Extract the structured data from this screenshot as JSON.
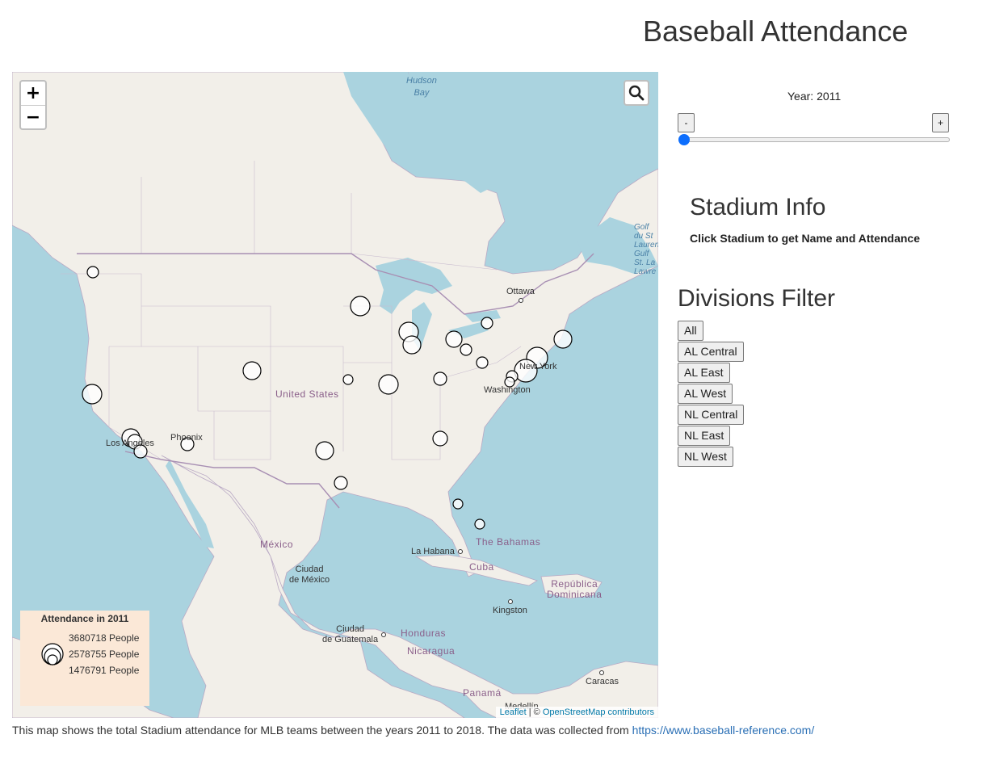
{
  "header": {
    "title": "Baseball Attendance"
  },
  "map": {
    "zoom_in_label": "+",
    "zoom_out_label": "−",
    "search_icon": "search-icon",
    "labels": [
      {
        "key": "hudson",
        "text": "Hudson\nBay",
        "kind": "water"
      },
      {
        "key": "golf",
        "text": "Golf\ndu St\nLauren\nGulf\nSt. La\nLawre",
        "kind": "water"
      },
      {
        "key": "ottawa",
        "text": "Ottawa",
        "kind": "city"
      },
      {
        "key": "newyork",
        "text": "New York",
        "kind": "city"
      },
      {
        "key": "washington",
        "text": "Washington",
        "kind": "city"
      },
      {
        "key": "usa",
        "text": "United States",
        "kind": "country"
      },
      {
        "key": "phoenix",
        "text": "Phoenix",
        "kind": "city"
      },
      {
        "key": "losangeles",
        "text": "Los Angeles",
        "kind": "city"
      },
      {
        "key": "mexico",
        "text": "México",
        "kind": "country"
      },
      {
        "key": "cdmx",
        "text": "Ciudad\nde México",
        "kind": "city"
      },
      {
        "key": "bahamas",
        "text": "The Bahamas",
        "kind": "country"
      },
      {
        "key": "habana",
        "text": "La Habana",
        "kind": "city"
      },
      {
        "key": "cuba",
        "text": "Cuba",
        "kind": "country"
      },
      {
        "key": "repdom",
        "text": "República\nDominicana",
        "kind": "country"
      },
      {
        "key": "kingston",
        "text": "Kingston",
        "kind": "city"
      },
      {
        "key": "honduras",
        "text": "Honduras",
        "kind": "country"
      },
      {
        "key": "guatemala",
        "text": "Ciudad\nde Guatemala",
        "kind": "city"
      },
      {
        "key": "nicaragua",
        "text": "Nicaragua",
        "kind": "country"
      },
      {
        "key": "caracas",
        "text": "Caracas",
        "kind": "city"
      },
      {
        "key": "panama",
        "text": "Panamá",
        "kind": "country"
      },
      {
        "key": "medellin",
        "text": "Medellín",
        "kind": "city"
      }
    ],
    "legend": {
      "title": "Attendance in 2011",
      "entries": [
        "3680718 People",
        "2578755 People",
        "1476791 People"
      ]
    },
    "attribution": {
      "leaflet": "Leaflet",
      "sep": " | © ",
      "osm": "OpenStreetMap contributors"
    }
  },
  "controls": {
    "year_label": "Year: 2011",
    "decrement_label": "-",
    "increment_label": "+",
    "slider_value": 2011,
    "slider_min": 2011,
    "slider_max": 2018
  },
  "stadium_info": {
    "title": "Stadium Info",
    "prompt": "Click Stadium to get Name and Attendance"
  },
  "divisions": {
    "title": "Divisions Filter",
    "buttons": [
      "All",
      "AL Central",
      "AL East",
      "AL West",
      "NL Central",
      "NL East",
      "NL West"
    ]
  },
  "footer": {
    "text": "This map shows the total Stadium attendance for MLB teams between the years 2011 to 2018. The data was collected from ",
    "link": "https://www.baseball-reference.com/"
  },
  "colors": {
    "water": "#aad3df",
    "land": "#f2efe9",
    "legend_bg": "#fbe8d7",
    "slider_thumb": "#0d6efd"
  }
}
